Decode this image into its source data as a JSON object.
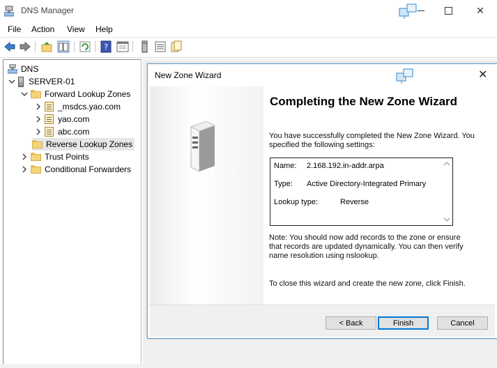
{
  "window": {
    "title": "DNS Manager"
  },
  "menu": {
    "items": [
      "File",
      "Action",
      "View",
      "Help"
    ]
  },
  "toolbar": {
    "buttons": [
      "back-icon",
      "forward-icon",
      "up-folder-icon",
      "show-hide-tree-icon",
      "refresh-icon",
      "help-icon",
      "properties-icon",
      "server-icon",
      "list-icon",
      "zone-icon"
    ]
  },
  "tree": {
    "root": "DNS",
    "server": "SERVER-01",
    "forward": "Forward Lookup Zones",
    "zones": [
      "_msdcs.yao.com",
      "yao.com",
      "abc.com"
    ],
    "reverse": "Reverse Lookup Zones",
    "trust": "Trust Points",
    "conditional": "Conditional Forwarders"
  },
  "wizard": {
    "title": "New Zone Wizard",
    "heading": "Completing the New Zone Wizard",
    "intro": "You have successfully completed the New Zone Wizard. You specified the following settings:",
    "settings": {
      "name_label": "Name:",
      "name_value": "2.168.192.in-addr.arpa",
      "type_label": "Type:",
      "type_value": "Active Directory-Integrated Primary",
      "lookup_label": "Lookup type:",
      "lookup_value": "Reverse"
    },
    "note": "Note: You should now add records to the zone or ensure that records are updated dynamically. You can then verify name resolution using nslookup.",
    "closing": "To close this wizard and create the new zone, click Finish.",
    "buttons": {
      "back": "< Back",
      "finish": "Finish",
      "cancel": "Cancel"
    }
  },
  "colors": {
    "accent": "#0078d7",
    "folder": "#f4d47a",
    "selection": "#e6e6e6"
  }
}
